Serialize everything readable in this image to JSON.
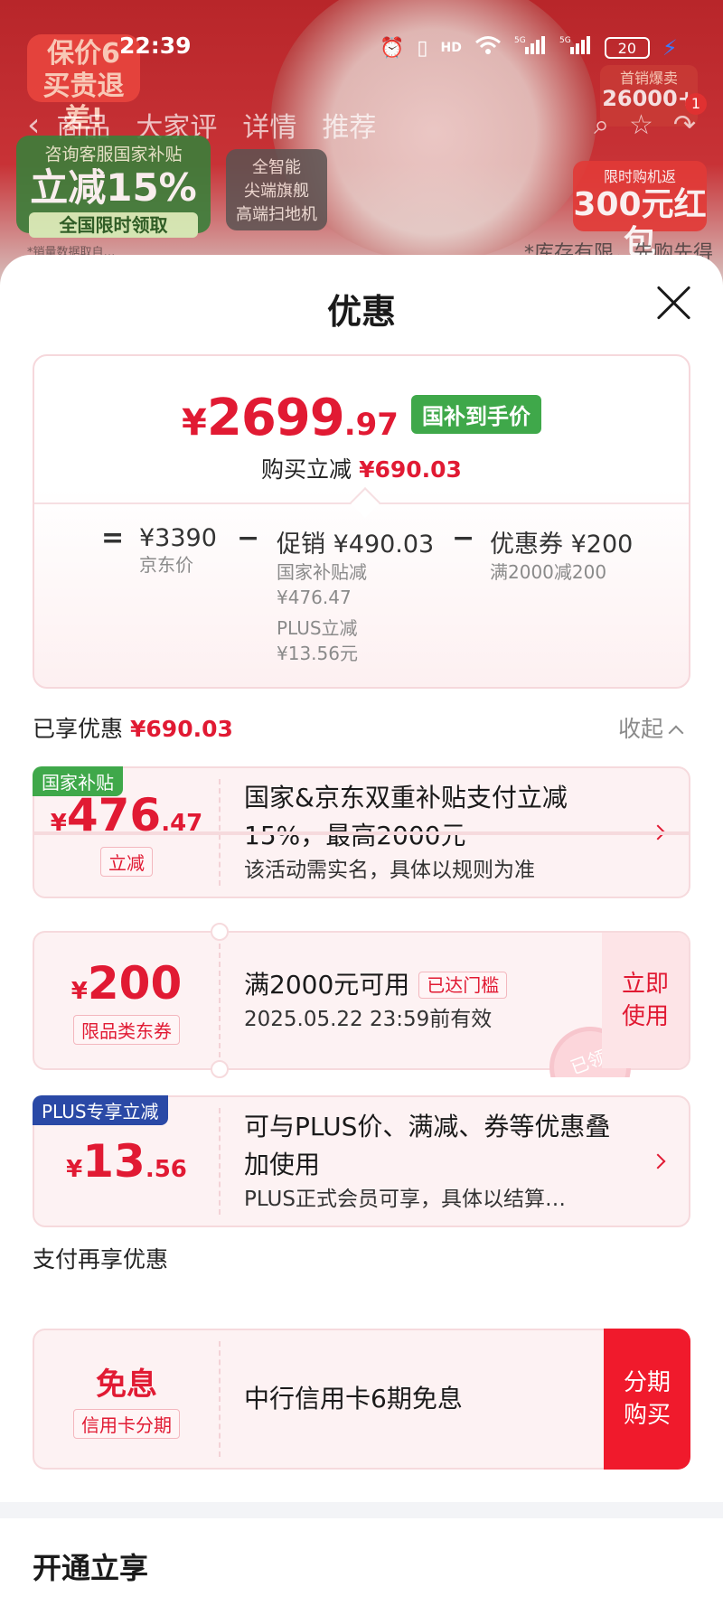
{
  "background": {
    "badge_left": "保价6\n买贵退差!",
    "nav_tabs": [
      "商品",
      "大家评",
      "详情",
      "推荐"
    ],
    "cart_badge": "1",
    "subsidy_top": "咨询客服国家补贴",
    "subsidy_main": "立减15%",
    "subsidy_bottom": "全国限时领取",
    "flagship": "全智能\n尖端旗舰\n高端扫地机",
    "top_right_a": "首销爆卖",
    "top_right_b": "26000+",
    "red_right_a": "限时购机返",
    "red_right_b": "300元红包",
    "bottom_note": "*销量数据取自…",
    "stock_note": "*库存有限，先购先得"
  },
  "status_bar": {
    "time": "22:39",
    "battery": "20"
  },
  "sheet": {
    "title": "优惠",
    "price": {
      "yen": "¥",
      "integer": "2699",
      "decimal": ".97",
      "tag": "国补到手价",
      "sub_label": "购买立减",
      "sub_value": "¥690.03"
    },
    "breakdown": {
      "eq": "=",
      "minus": "−",
      "jd_price": "¥3390",
      "jd_label": "京东价",
      "promo": "促销 ¥490.03",
      "promo_sub1": "国家补贴减",
      "promo_sub2": "¥476.47",
      "promo_sub3": "PLUS立减",
      "promo_sub4": "¥13.56元",
      "coupon": "优惠券 ¥200",
      "coupon_sub": "满2000减200"
    },
    "enjoyed_label": "已享优惠",
    "enjoyed_value": "¥690.03",
    "collapse_label": "收起",
    "cards": [
      {
        "corner": "国家补贴",
        "yen": "¥",
        "int": "476",
        "dec": ".47",
        "pill": "立减",
        "title": "国家&京东双重补贴支付立减15%，最高2000元",
        "desc": "该活动需实名，具体以规则为准"
      },
      {
        "yen": "¥",
        "int": "200",
        "dec": "",
        "pill": "限品类东券",
        "title": "满2000元可用",
        "reached": "已达门槛",
        "desc": "2025.05.22 23:59前有效",
        "button": "立即\n使用",
        "stamp": "已领"
      },
      {
        "corner": "PLUS专享立减",
        "yen": "¥",
        "int": "13",
        "dec": ".56",
        "title": "可与PLUS价、满减、券等优惠叠加使用",
        "desc": "PLUS正式会员可享，具体以结算…"
      }
    ],
    "pay_title": "支付再享优惠",
    "pay_card": {
      "big": "免息",
      "pill": "信用卡分期",
      "title": "中行信用卡6期免息",
      "button": "分期\n购买"
    },
    "open_title": "开通立享"
  },
  "colors": {
    "accent_red": "#e11a33",
    "green_tag": "#3fa84a",
    "plus_blue": "#2a49a6"
  }
}
